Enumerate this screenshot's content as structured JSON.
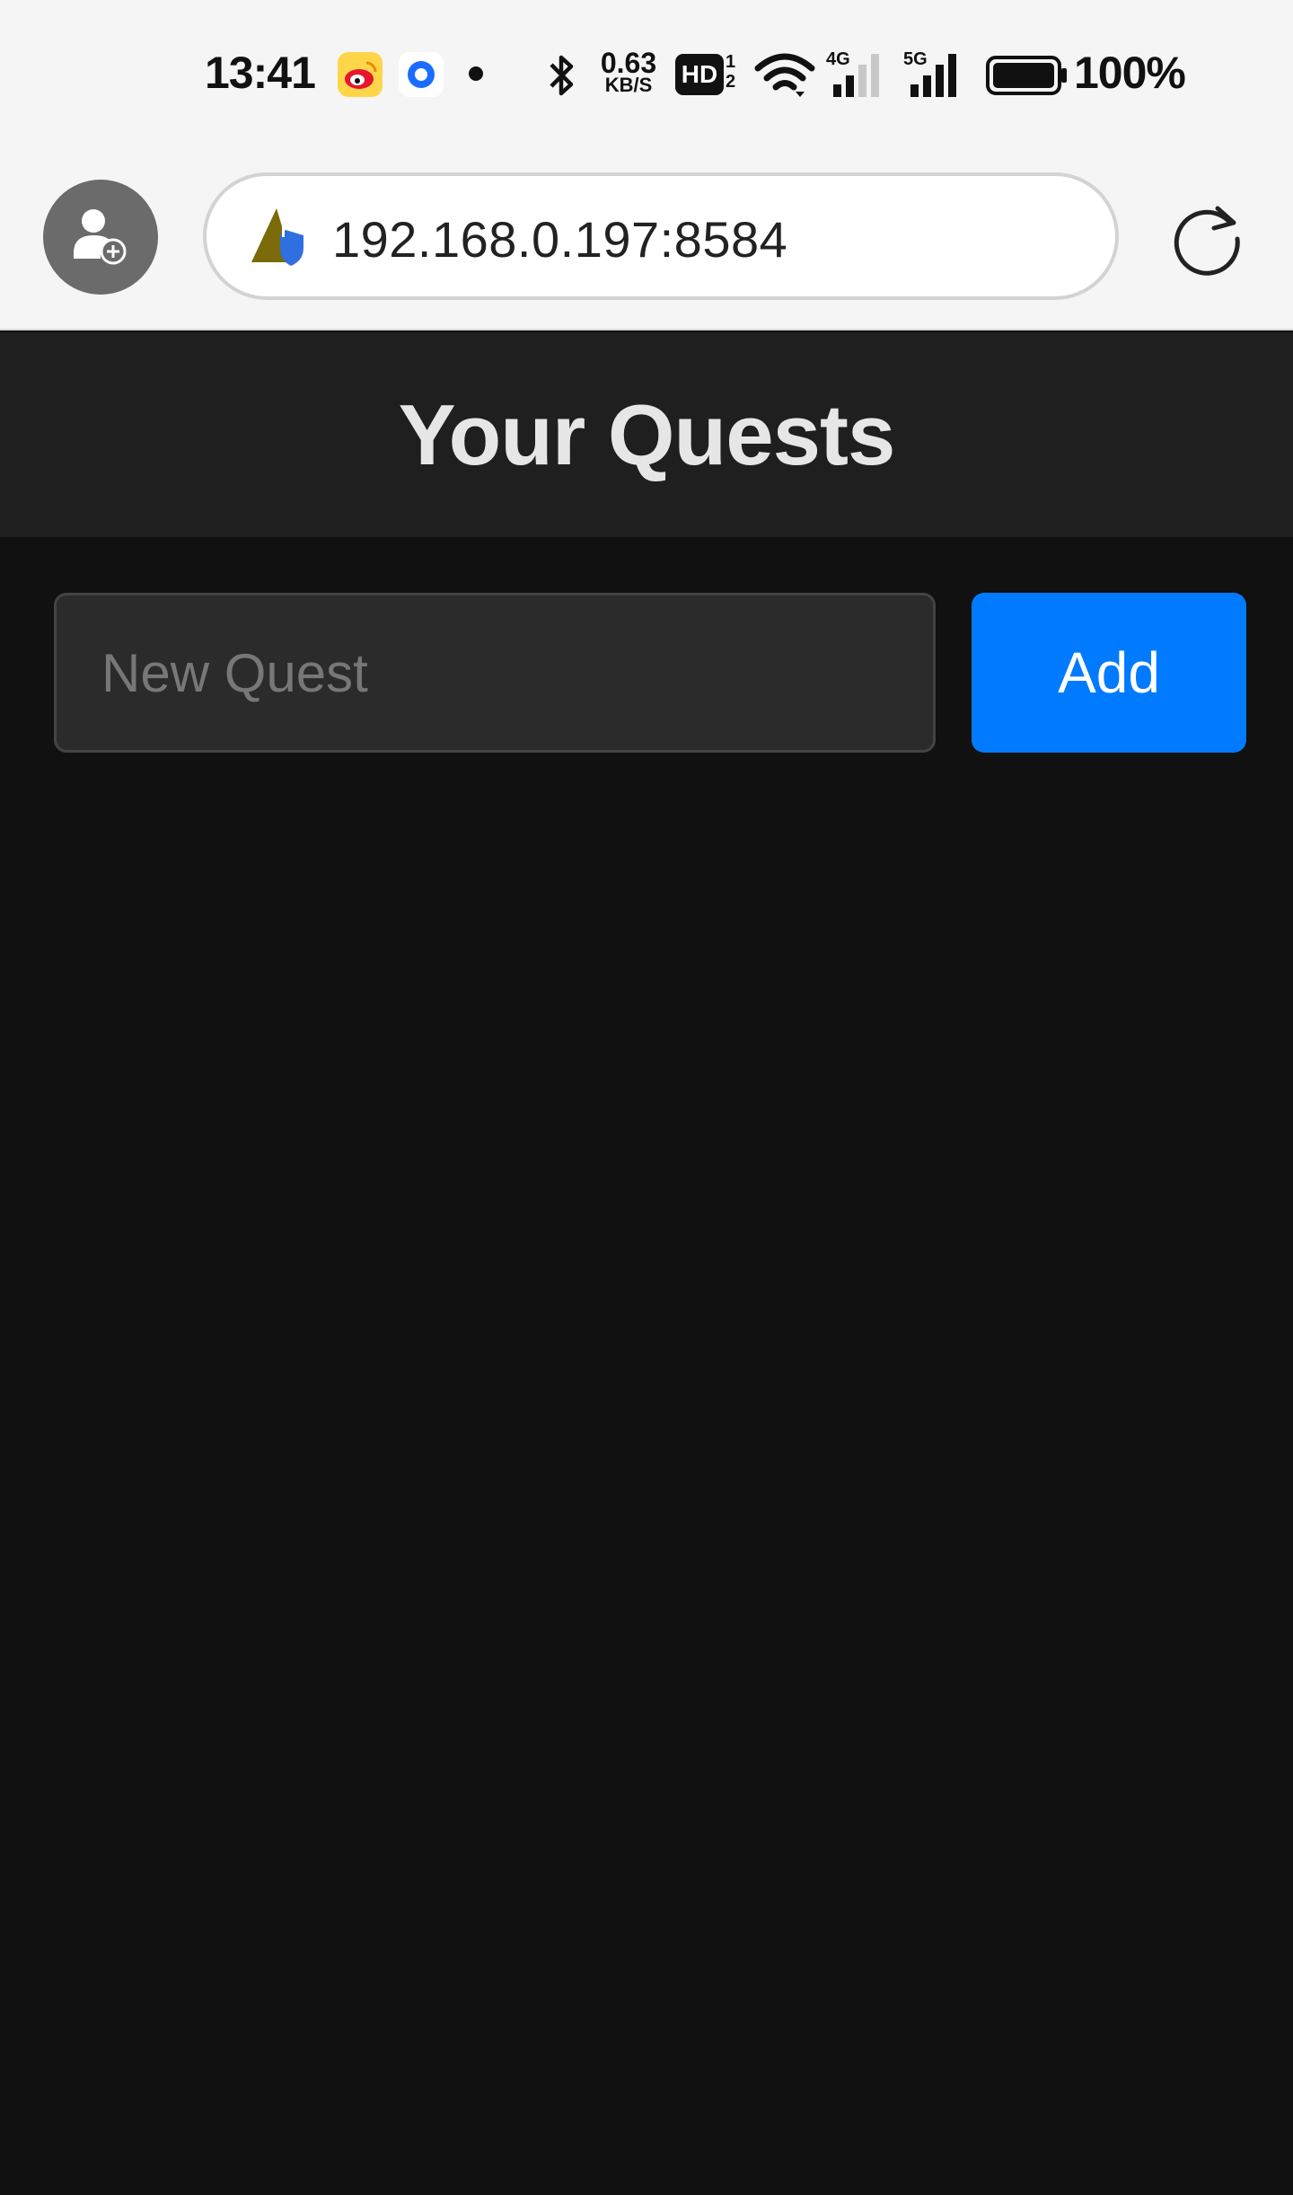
{
  "status_bar": {
    "time": "13:41",
    "net_speed_value": "0.63",
    "net_speed_unit": "KB/S",
    "hd_label": "HD",
    "hd_sub_top": "1",
    "hd_sub_bottom": "2",
    "signal_1_label": "4G",
    "signal_2_label": "5G",
    "battery_percent": "100%",
    "icons": [
      "weibo-icon",
      "qq-browser-icon",
      "notification-dot-icon",
      "bluetooth-icon",
      "wifi-icon",
      "signal-icon",
      "battery-icon"
    ]
  },
  "browser": {
    "url": "192.168.0.197:8584",
    "icons": [
      "profile-add-icon",
      "insecure-warning-icon",
      "reload-icon"
    ]
  },
  "app": {
    "title": "Your Quests",
    "input_placeholder": "New Quest",
    "input_value": "",
    "add_button_label": "Add",
    "quests": []
  },
  "colors": {
    "header_bg": "#1f1f1f",
    "page_bg": "#111111",
    "accent": "#007bff",
    "input_bg": "#2b2b2b",
    "title_text": "#e6e6e6"
  }
}
